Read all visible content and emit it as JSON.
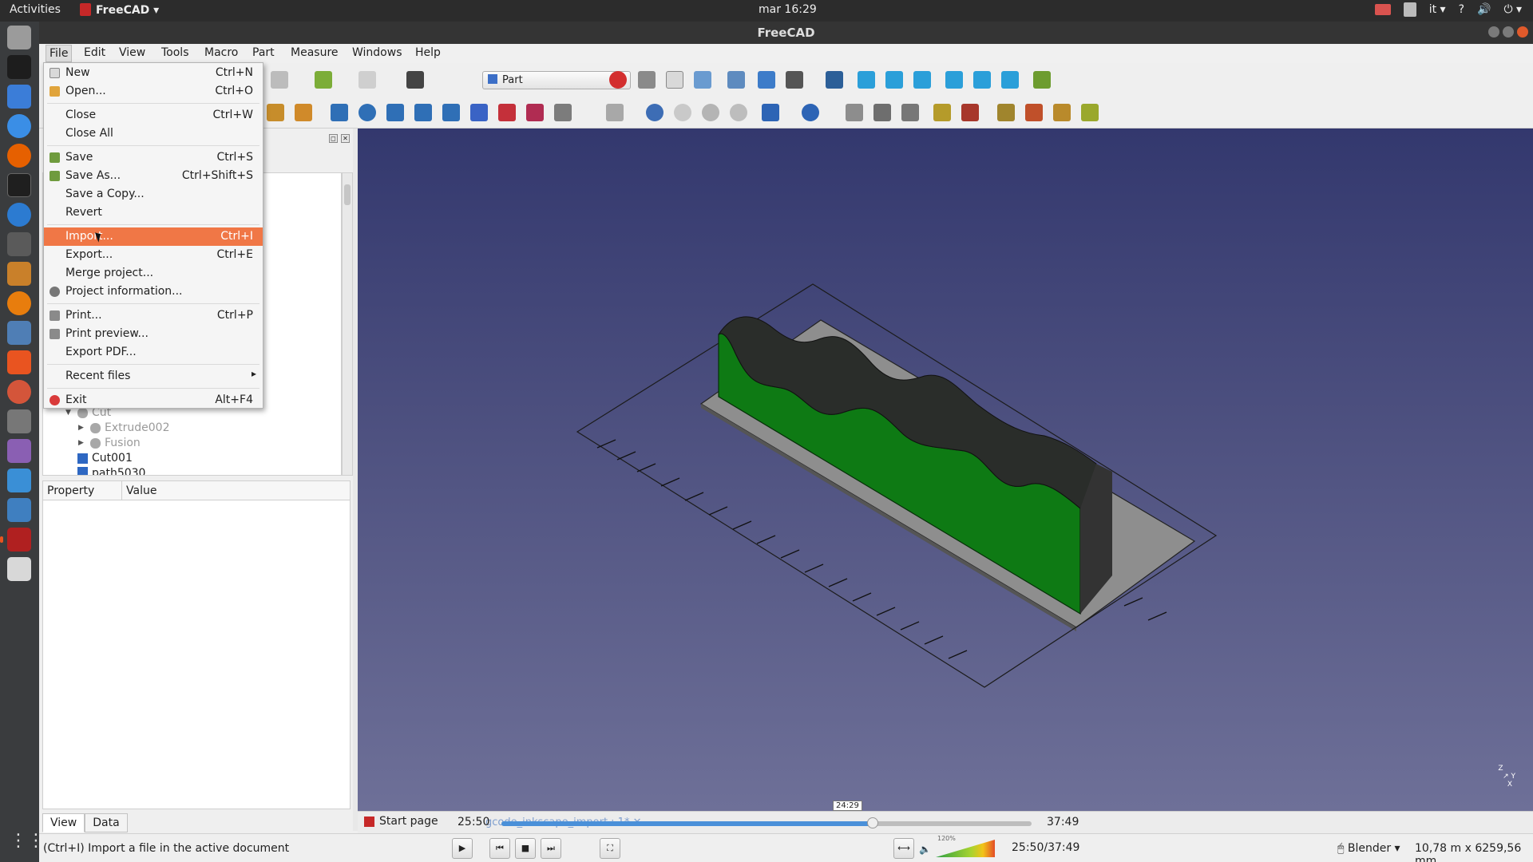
{
  "topbar": {
    "activities": "Activities",
    "app": "FreeCAD",
    "clock": "mar 16:29",
    "lang": "it",
    "help": "?"
  },
  "window": {
    "title": "FreeCAD"
  },
  "menubar": [
    "File",
    "Edit",
    "View",
    "Tools",
    "Macro",
    "Part",
    "Measure",
    "Windows",
    "Help"
  ],
  "toolbar": {
    "workbench": "Part"
  },
  "file_menu": {
    "items": [
      {
        "label": "New",
        "shortcut": "Ctrl+N",
        "icon": "new-file-icon"
      },
      {
        "label": "Open...",
        "shortcut": "Ctrl+O",
        "icon": "open-folder-icon"
      },
      {
        "label": "Close",
        "shortcut": "Ctrl+W"
      },
      {
        "label": "Close All",
        "shortcut": ""
      },
      {
        "label": "Save",
        "shortcut": "Ctrl+S",
        "icon": "save-icon"
      },
      {
        "label": "Save As...",
        "shortcut": "Ctrl+Shift+S",
        "icon": "save-as-icon"
      },
      {
        "label": "Save a Copy...",
        "shortcut": ""
      },
      {
        "label": "Revert",
        "shortcut": ""
      },
      {
        "label": "Import...",
        "shortcut": "Ctrl+I"
      },
      {
        "label": "Export...",
        "shortcut": "Ctrl+E"
      },
      {
        "label": "Merge project...",
        "shortcut": ""
      },
      {
        "label": "Project information...",
        "shortcut": "",
        "icon": "gear-icon"
      },
      {
        "label": "Print...",
        "shortcut": "Ctrl+P",
        "icon": "printer-icon"
      },
      {
        "label": "Print preview...",
        "shortcut": "",
        "icon": "print-preview-icon"
      },
      {
        "label": "Export PDF...",
        "shortcut": ""
      },
      {
        "label": "Recent files",
        "shortcut": ""
      },
      {
        "label": "Exit",
        "shortcut": "Alt+F4",
        "icon": "exit-icon"
      }
    ],
    "highlighted": "Import..."
  },
  "tree": {
    "items": [
      {
        "label": "Cut",
        "level": 1,
        "expanded": true
      },
      {
        "label": "Extrude002",
        "level": 2
      },
      {
        "label": "Fusion",
        "level": 2
      },
      {
        "label": "Cut001",
        "level": 1
      },
      {
        "label": "path5030",
        "level": 1
      }
    ]
  },
  "property": {
    "col_property": "Property",
    "col_value": "Value"
  },
  "view_tabs": [
    "View",
    "Data"
  ],
  "doc_tabs": {
    "start": "Start page",
    "doc": "gcode_inkscape_import : 1*"
  },
  "video": {
    "current": "25:50",
    "total": "37:49",
    "hover": "24:29",
    "progress_fraction": 0.7,
    "volume_label": "120%",
    "play_time": "25:50/37:49"
  },
  "status": {
    "message": "(Ctrl+I) Import a file in the active document",
    "nav_style": "Blender",
    "dimensions": "10,78 m x 6259,56 mm"
  },
  "colors": {
    "accent": "#f07746",
    "view_top": "#33386e",
    "view_bottom": "#6e7098",
    "model": "#0e7a14"
  }
}
